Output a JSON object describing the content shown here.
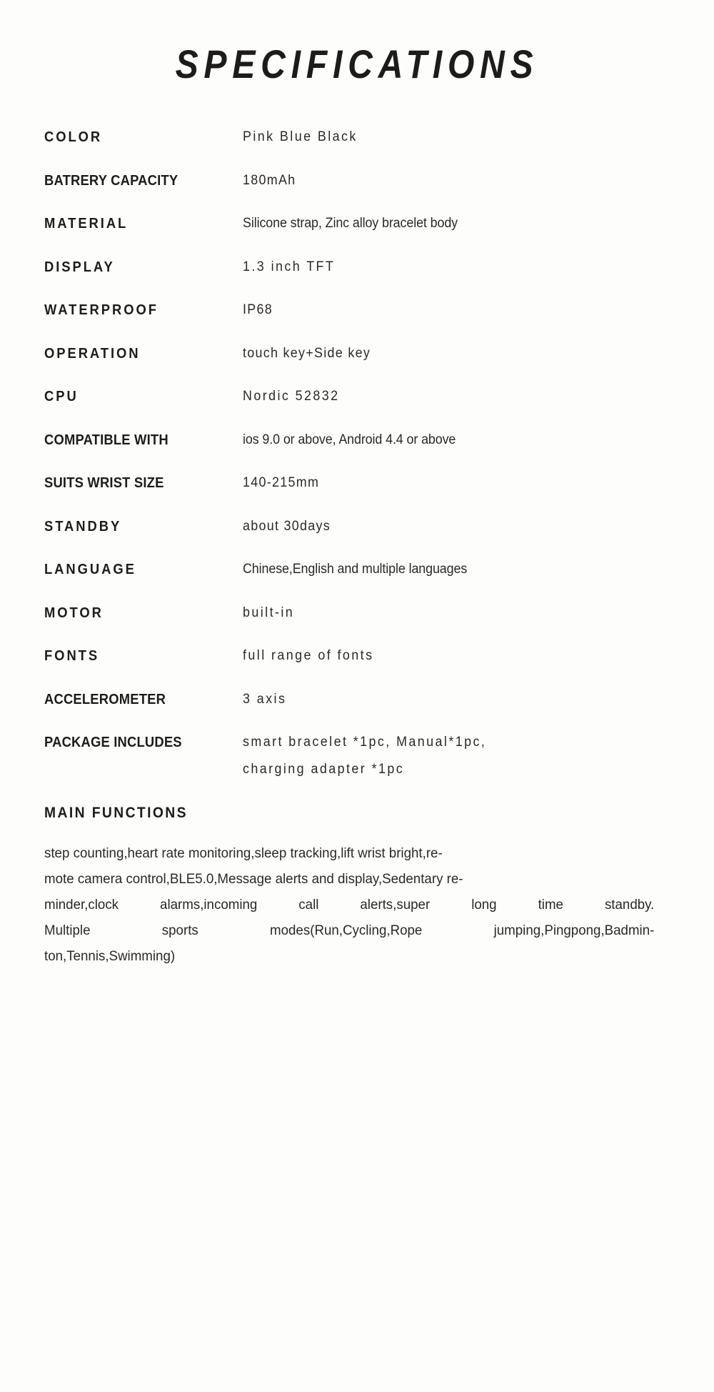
{
  "page": {
    "title": "SPECIFICATIONS",
    "background_color": "#fdfdfc",
    "text_color": "#231f20"
  },
  "specs": {
    "rows": [
      {
        "label": "COLOR",
        "value": "Pink     Blue     Black"
      },
      {
        "label": "BATRERY CAPACITY",
        "value": "180mAh"
      },
      {
        "label": "MATERIAL",
        "value": "Silicone strap, Zinc alloy bracelet body"
      },
      {
        "label": "DISPLAY",
        "value": "1.3 inch TFT"
      },
      {
        "label": "WATERPROOF",
        "value": "IP68"
      },
      {
        "label": "OPERATION",
        "value": "touch key+Side key"
      },
      {
        "label": "CPU",
        "value": "Nordic  52832"
      },
      {
        "label": "COMPATIBLE WITH",
        "value": "ios 9.0 or above, Android 4.4 or above"
      },
      {
        "label": "SUITS WRIST SIZE",
        "value": "140-215mm"
      },
      {
        "label": "STANDBY",
        "value": "about 30days"
      },
      {
        "label": "LANGUAGE",
        "value": "Chinese,English and multiple languages"
      },
      {
        "label": "MOTOR",
        "value": "built-in"
      },
      {
        "label": "FONTS",
        "value": "full range of fonts"
      },
      {
        "label": "ACCELEROMETER",
        "value": "3 axis"
      },
      {
        "label": "PACKAGE INCLUDES",
        "value_line_1": "smart bracelet *1pc, Manual*1pc,",
        "value_line_2": "charging adapter *1pc"
      }
    ]
  },
  "main_functions": {
    "heading": "MAIN FUNCTIONS",
    "text": "step counting,heart rate monitoring,sleep tracking,lift wrist bright,remote camera control,BLE5.0,Message alerts and display,Sedentary reminder,clock alarms,incoming call alerts,super long time standby. Multiple sports modes(Run,Cycling,Rope jumping,Pingpong,Badminton,Tennis,Swimming)",
    "lines": [
      {
        "left": "step counting,heart rate monitoring,sleep tracking,lift wrist bright,re-"
      },
      {
        "left": "mote camera control,BLE5.0,Message alerts and display,Sedentary re-"
      },
      {
        "a": "minder,clock",
        "b": "alarms,incoming",
        "c": "call",
        "d": "alerts,super",
        "e": "long",
        "f": "time",
        "g": "standby."
      },
      {
        "a": "Multiple",
        "b": "sports",
        "c": "modes(Run,Cycling,Rope",
        "d": "jumping,Pingpong,Badmin-"
      },
      {
        "left": "ton,Tennis,Swimming)"
      }
    ]
  }
}
